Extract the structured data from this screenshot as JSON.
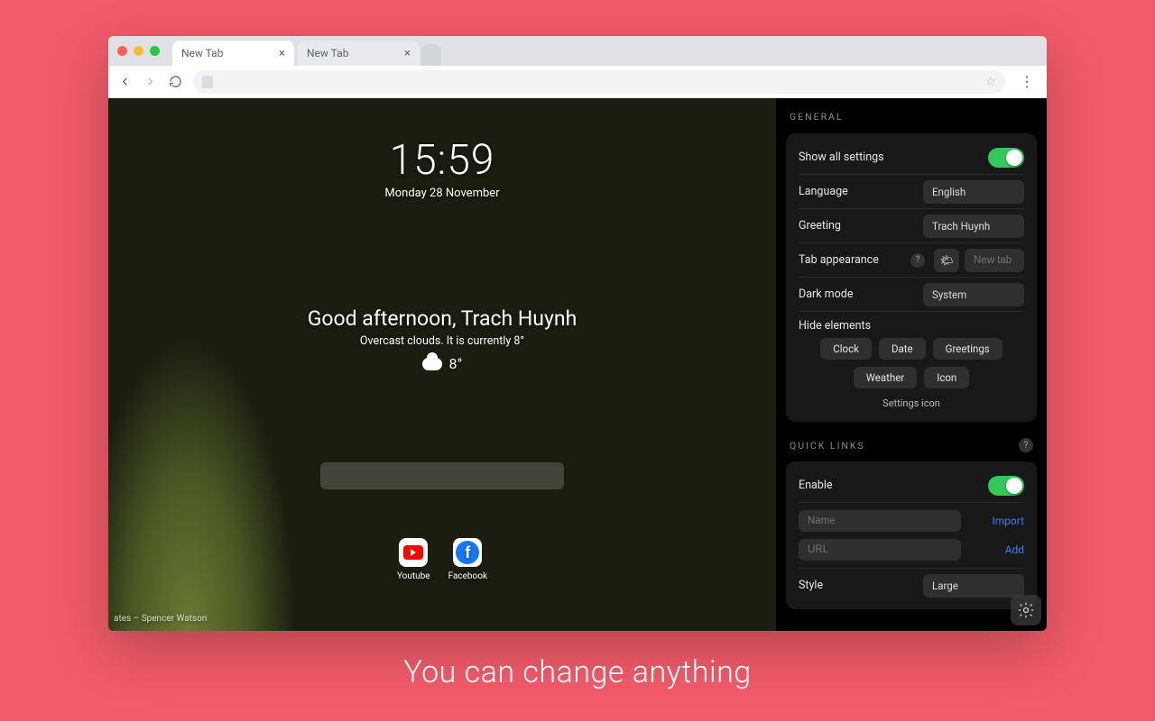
{
  "promo": {
    "caption": "You can change anything"
  },
  "browser": {
    "tabs": [
      {
        "label": "New Tab"
      },
      {
        "label": "New Tab"
      }
    ]
  },
  "newtab": {
    "clock": "15:59",
    "date": "Monday 28 November",
    "greeting": "Good afternoon, Trach Huynh",
    "weather_line": "Overcast clouds. It is currently 8°",
    "temp": "8°",
    "quicklinks": [
      {
        "name": "Youtube"
      },
      {
        "name": "Facebook"
      }
    ],
    "credit": "ates – Spencer Watson"
  },
  "settings": {
    "general": {
      "section": "GENERAL",
      "show_all": "Show all settings",
      "language": {
        "label": "Language",
        "value": "English"
      },
      "greeting": {
        "label": "Greeting",
        "value": "Trach Huynh"
      },
      "tab_appearance": {
        "label": "Tab appearance",
        "placeholder": "New tab"
      },
      "dark_mode": {
        "label": "Dark mode",
        "value": "System"
      },
      "hide": {
        "label": "Hide elements",
        "chips": [
          "Clock",
          "Date",
          "Greetings",
          "Weather",
          "Icon"
        ],
        "footer": "Settings icon"
      }
    },
    "quicklinks": {
      "section": "QUICK LINKS",
      "enable": "Enable",
      "name_placeholder": "Name",
      "url_placeholder": "URL",
      "import": "Import",
      "add": "Add",
      "style": {
        "label": "Style",
        "value": "Large"
      }
    }
  }
}
